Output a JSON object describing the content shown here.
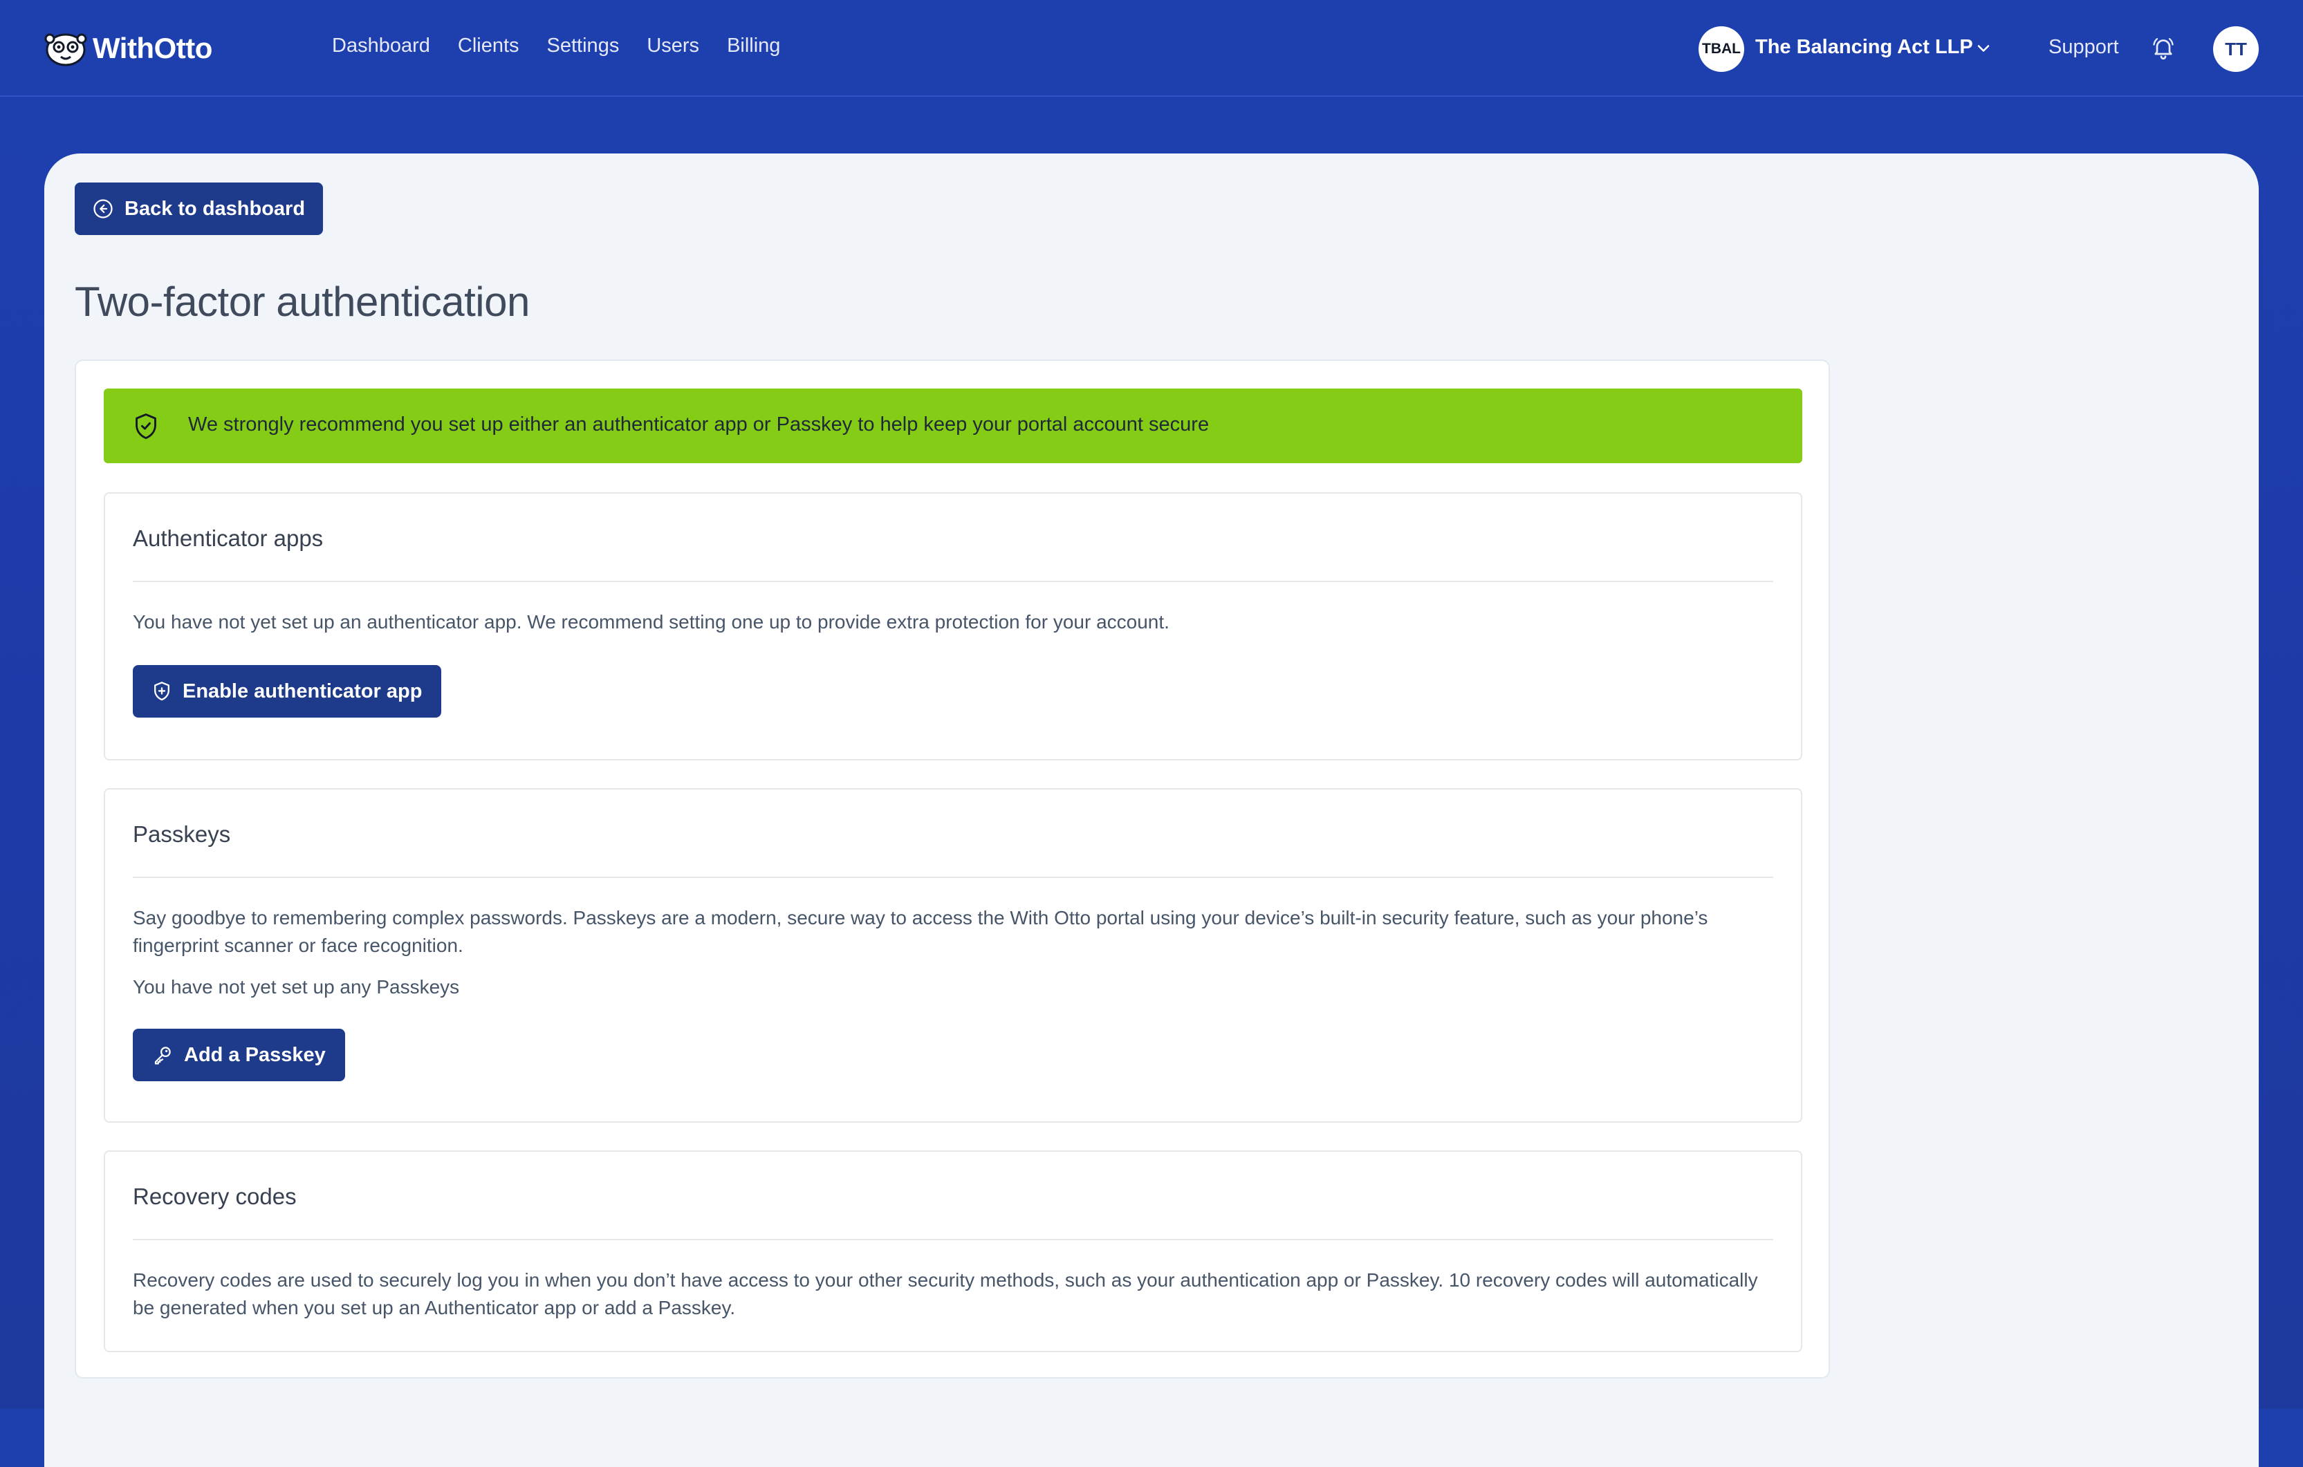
{
  "brand": {
    "name": "WithOtto"
  },
  "nav": {
    "items": [
      "Dashboard",
      "Clients",
      "Settings",
      "Users",
      "Billing"
    ]
  },
  "org": {
    "initials": "TBAL",
    "name": "The Balancing Act LLP"
  },
  "header": {
    "support_label": "Support",
    "user_initials": "TT"
  },
  "main": {
    "back_label": "Back to dashboard",
    "title": "Two-factor authentication",
    "alert_text": "We strongly recommend you set up either an authenticator app or Passkey to help keep your portal account secure",
    "auth_apps": {
      "title": "Authenticator apps",
      "description": "You have not yet set up an authenticator app. We recommend setting one up to provide extra protection for your account.",
      "button": "Enable authenticator app"
    },
    "passkeys": {
      "title": "Passkeys",
      "description": "Say goodbye to remembering complex passwords. Passkeys are a modern, secure way to access the With Otto portal using your device’s built-in security feature, such as your phone’s fingerprint scanner or face recognition.",
      "status": "You have not yet set up any Passkeys",
      "button": "Add a Passkey"
    },
    "recovery": {
      "title": "Recovery codes",
      "description": "Recovery codes are used to securely log you in when you don’t have access to your other security methods, such as your authentication app or Passkey. 10 recovery codes will automatically be generated when you set up an Authenticator app or add a Passkey."
    }
  },
  "colors": {
    "header_bg": "#1e40af",
    "button_bg": "#1e3a8a",
    "alert_bg": "#84cc16",
    "panel_bg": "#f1f5f9"
  }
}
